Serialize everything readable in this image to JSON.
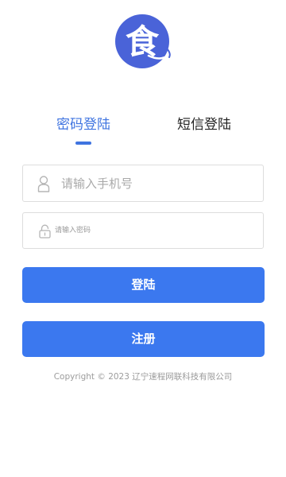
{
  "logo": {
    "glyph": "食",
    "bg_color": "#4a63d8",
    "icon": "food-character-logo-icon"
  },
  "tabs": [
    {
      "label": "密码登陆",
      "active": true
    },
    {
      "label": "短信登陆",
      "active": false
    }
  ],
  "phone_field": {
    "placeholder": "请输入手机号",
    "value": "",
    "icon": "user-icon"
  },
  "password_field": {
    "placeholder": "请输入密码",
    "value": "",
    "icon": "lock-icon"
  },
  "buttons": {
    "login_label": "登陆",
    "register_label": "注册"
  },
  "footer": {
    "copyright": "Copyright © 2023 辽宁速程网联科技有限公司"
  },
  "colors": {
    "accent": "#3b78ef",
    "active_tab": "#3f74e0",
    "inactive_tab": "#222222",
    "border": "#dddddd"
  }
}
